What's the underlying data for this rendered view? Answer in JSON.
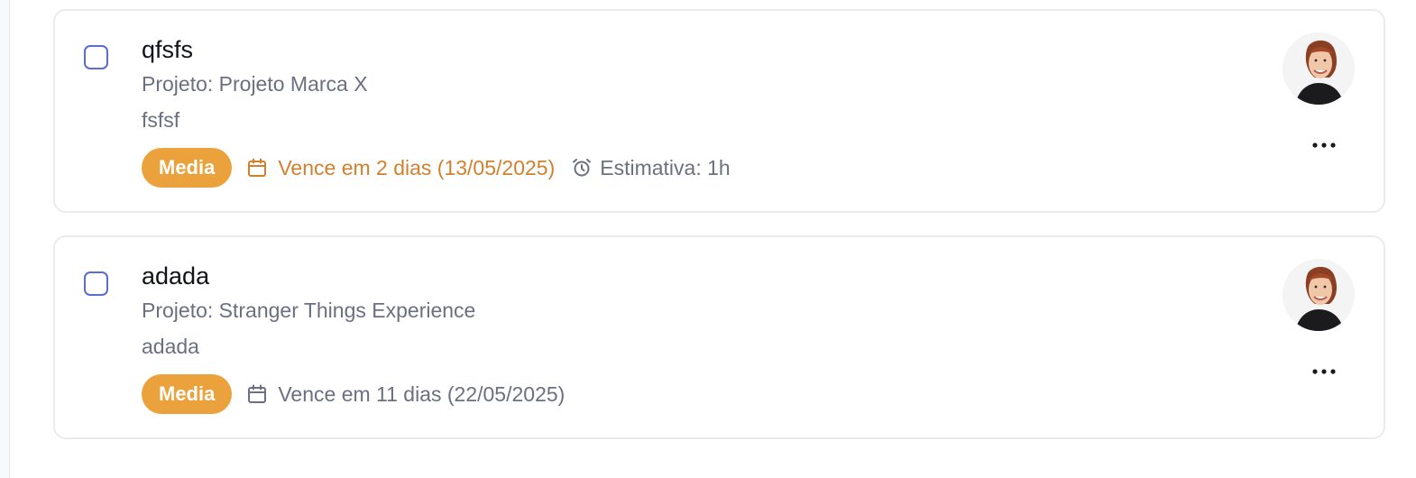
{
  "colors": {
    "checkbox_border": "#5a6ad8",
    "badge_bg": "#eba23c",
    "due_soon": "#d3802e",
    "muted_text": "#6b7080"
  },
  "tasks": [
    {
      "title": "qfsfs",
      "project": "Projeto: Projeto Marca X",
      "description": "fsfsf",
      "priority": "Media",
      "due": "Vence em 2 dias (13/05/2025)",
      "due_status": "soon",
      "estimate": "Estimativa: 1h",
      "calendar_icon": "calendar-icon",
      "alarm_icon": "alarm-clock-icon",
      "more_icon": "more-horizontal-icon"
    },
    {
      "title": "adada",
      "project": "Projeto: Stranger Things Experience",
      "description": "adada",
      "priority": "Media",
      "due": "Vence em 11 dias (22/05/2025)",
      "due_status": "normal",
      "calendar_icon": "calendar-icon",
      "more_icon": "more-horizontal-icon"
    }
  ]
}
